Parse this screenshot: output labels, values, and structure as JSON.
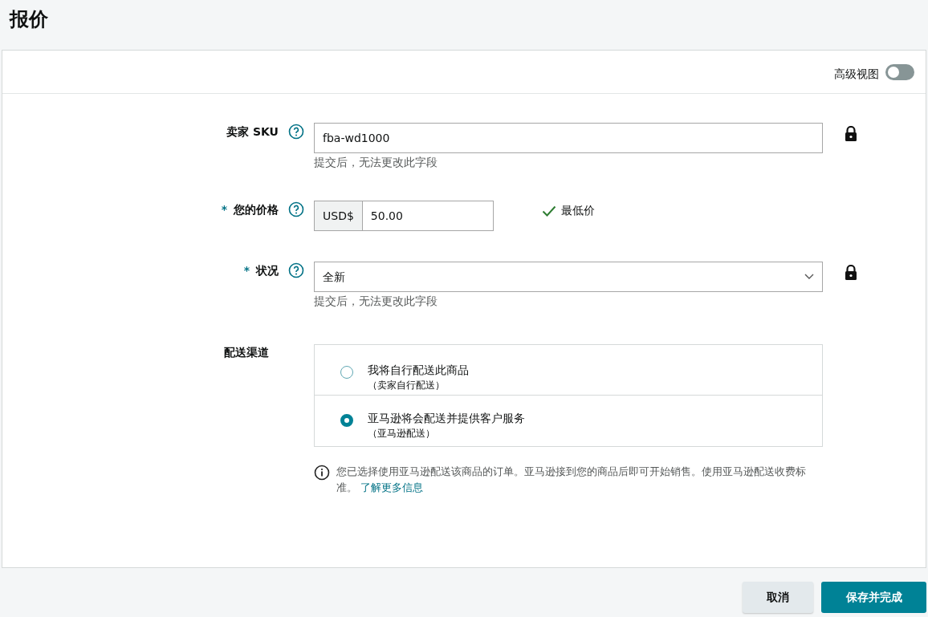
{
  "title": "报价",
  "advanced_view": {
    "label": "高级视图",
    "on": false
  },
  "fields": [
    {
      "kind": "text",
      "label": "卖家 SKU",
      "value": "fba-wd1000",
      "hint": "提交后，无法更改此字段",
      "locked": true
    },
    {
      "kind": "price",
      "required_mark": "*",
      "label": "您的价格",
      "currency": "USD$",
      "value": "50.00",
      "status": "最低价",
      "locked": false
    },
    {
      "kind": "select",
      "required_mark": "*",
      "label": "状况",
      "value": "全新",
      "hint": "提交后，无法更改此字段",
      "locked": true
    }
  ],
  "fulfillment": {
    "label": "配送渠道",
    "options": [
      {
        "title": "我将自行配送此商品",
        "subtitle": "（卖家自行配送）",
        "selected": false
      },
      {
        "title": "亚马逊将会配送并提供客户服务",
        "subtitle": "（亚马逊配送）",
        "selected": true
      }
    ]
  },
  "note": {
    "text": "您已选择使用亚马逊配送该商品的订单。亚马逊接到您的商品后即可开始销售。使用亚马逊配送收费标准。",
    "link": "了解更多信息"
  },
  "buttons": [
    {
      "kind": "secondary",
      "label": "取消"
    },
    {
      "kind": "primary",
      "label": "保存并完成"
    }
  ]
}
